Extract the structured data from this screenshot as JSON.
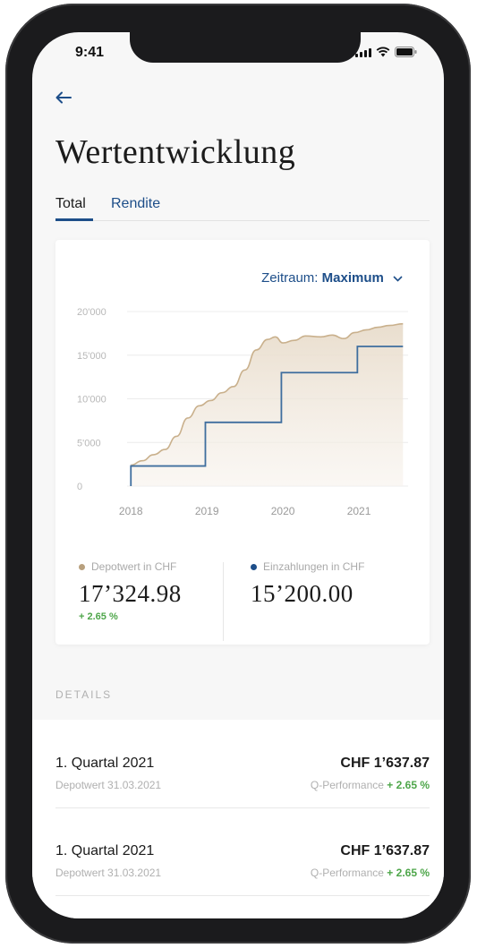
{
  "status_bar": {
    "time": "9:41"
  },
  "header": {
    "back_icon": "arrow-left-icon",
    "title": "Wertentwicklung"
  },
  "tabs": [
    {
      "label": "Total",
      "active": true
    },
    {
      "label": "Rendite",
      "active": false
    }
  ],
  "colors": {
    "accent": "#1d4e89",
    "depot": "#b8a07e",
    "positive": "#4ea64a"
  },
  "chart_card": {
    "zeitraum_label": "Zeitraum:",
    "zeitraum_value": "Maximum"
  },
  "chart_data": {
    "type": "area",
    "ylim": [
      0,
      20000
    ],
    "y_tick_labels": [
      "20'000",
      "15'000",
      "10'000",
      "5'000",
      "0"
    ],
    "y_ticks": [
      20000,
      15000,
      10000,
      5000,
      0
    ],
    "x_tick_labels": [
      "2018",
      "2019",
      "2020",
      "2021"
    ],
    "x_ticks": [
      2018,
      2019,
      2020,
      2021
    ],
    "xlim": [
      2017.95,
      2021.6
    ],
    "grid": true,
    "series": [
      {
        "name": "Depotwert in CHF",
        "style": "area",
        "x": [
          2018.0,
          2018.15,
          2018.3,
          2018.45,
          2018.6,
          2018.75,
          2018.9,
          2019.05,
          2019.2,
          2019.35,
          2019.5,
          2019.65,
          2019.8,
          2019.9,
          2020.0,
          2020.15,
          2020.3,
          2020.5,
          2020.65,
          2020.8,
          2020.95,
          2021.1,
          2021.25,
          2021.4,
          2021.58
        ],
        "y": [
          2400,
          2900,
          3600,
          4200,
          5700,
          7800,
          9200,
          9800,
          10700,
          11400,
          13300,
          15600,
          16800,
          17100,
          16400,
          16700,
          17200,
          17100,
          17300,
          16900,
          17600,
          17900,
          18200,
          18400,
          18600
        ]
      },
      {
        "name": "Einzahlungen in CHF",
        "style": "step",
        "x": [
          2018.0,
          2018.98,
          2019.98,
          2020.98,
          2021.58
        ],
        "y": [
          2300,
          7300,
          13000,
          16000,
          16000
        ],
        "baseline": 0
      }
    ]
  },
  "summary": {
    "depot_label": "Depotwert in CHF",
    "depot_value": "17’324.98",
    "depot_change": "+ 2.65 %",
    "einzahlungen_label": "Einzahlungen in CHF",
    "einzahlungen_value": "15’200.00"
  },
  "details": {
    "heading": "DETAILS",
    "rows": [
      {
        "title": "1. Quartal 2021",
        "subtitle": "Depotwert 31.03.2021",
        "amount": "CHF 1’637.87",
        "perf_label": "Q-Performance",
        "perf_value": "+ 2.65 %"
      },
      {
        "title": "1. Quartal 2021",
        "subtitle": "Depotwert 31.03.2021",
        "amount": "CHF 1’637.87",
        "perf_label": "Q-Performance",
        "perf_value": "+ 2.65 %"
      }
    ]
  }
}
